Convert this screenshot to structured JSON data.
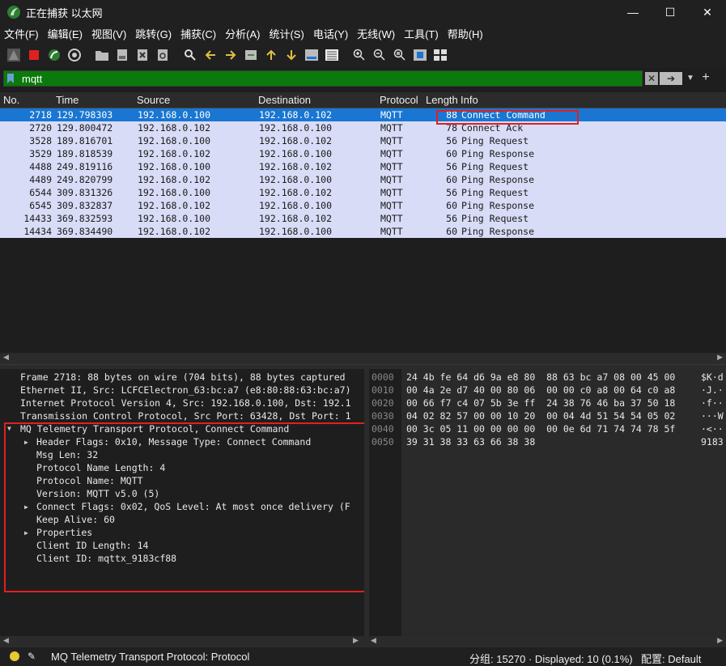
{
  "window": {
    "title": "正在捕获 以太网"
  },
  "menu": [
    "文件(F)",
    "编辑(E)",
    "视图(V)",
    "跳转(G)",
    "捕获(C)",
    "分析(A)",
    "统计(S)",
    "电话(Y)",
    "无线(W)",
    "工具(T)",
    "帮助(H)"
  ],
  "filter": {
    "value": "mqtt",
    "bg_color": "#0a7a0a"
  },
  "columns": {
    "no": "No.",
    "time": "Time",
    "source": "Source",
    "destination": "Destination",
    "protocol": "Protocol",
    "length": "Length",
    "info": "Info"
  },
  "packets": [
    {
      "no": "2718",
      "time": "129.798303",
      "src": "192.168.0.100",
      "dst": "192.168.0.102",
      "proto": "MQTT",
      "len": "88",
      "info": "Connect Command"
    },
    {
      "no": "2720",
      "time": "129.800472",
      "src": "192.168.0.102",
      "dst": "192.168.0.100",
      "proto": "MQTT",
      "len": "78",
      "info": "Connect Ack"
    },
    {
      "no": "3528",
      "time": "189.816701",
      "src": "192.168.0.100",
      "dst": "192.168.0.102",
      "proto": "MQTT",
      "len": "56",
      "info": "Ping Request"
    },
    {
      "no": "3529",
      "time": "189.818539",
      "src": "192.168.0.102",
      "dst": "192.168.0.100",
      "proto": "MQTT",
      "len": "60",
      "info": "Ping Response"
    },
    {
      "no": "4488",
      "time": "249.819116",
      "src": "192.168.0.100",
      "dst": "192.168.0.102",
      "proto": "MQTT",
      "len": "56",
      "info": "Ping Request"
    },
    {
      "no": "4489",
      "time": "249.820799",
      "src": "192.168.0.102",
      "dst": "192.168.0.100",
      "proto": "MQTT",
      "len": "60",
      "info": "Ping Response"
    },
    {
      "no": "6544",
      "time": "309.831326",
      "src": "192.168.0.100",
      "dst": "192.168.0.102",
      "proto": "MQTT",
      "len": "56",
      "info": "Ping Request"
    },
    {
      "no": "6545",
      "time": "309.832837",
      "src": "192.168.0.102",
      "dst": "192.168.0.100",
      "proto": "MQTT",
      "len": "60",
      "info": "Ping Response"
    },
    {
      "no": "14433",
      "time": "369.832593",
      "src": "192.168.0.100",
      "dst": "192.168.0.102",
      "proto": "MQTT",
      "len": "56",
      "info": "Ping Request"
    },
    {
      "no": "14434",
      "time": "369.834490",
      "src": "192.168.0.102",
      "dst": "192.168.0.100",
      "proto": "MQTT",
      "len": "60",
      "info": "Ping Response"
    }
  ],
  "details": [
    {
      "indent": 0,
      "arrow": "right",
      "text": "Frame 2718: 88 bytes on wire (704 bits), 88 bytes captured"
    },
    {
      "indent": 0,
      "arrow": "right",
      "text": "Ethernet II, Src: LCFCElectron_63:bc:a7 (e8:80:88:63:bc:a7)"
    },
    {
      "indent": 0,
      "arrow": "right",
      "text": "Internet Protocol Version 4, Src: 192.168.0.100, Dst: 192.1"
    },
    {
      "indent": 0,
      "arrow": "right",
      "text": "Transmission Control Protocol, Src Port: 63428, Dst Port: 1"
    },
    {
      "indent": 0,
      "arrow": "down",
      "text": "MQ Telemetry Transport Protocol, Connect Command"
    },
    {
      "indent": 1,
      "arrow": "right",
      "text": "Header Flags: 0x10, Message Type: Connect Command"
    },
    {
      "indent": 1,
      "arrow": "",
      "text": "Msg Len: 32"
    },
    {
      "indent": 1,
      "arrow": "",
      "text": "Protocol Name Length: 4"
    },
    {
      "indent": 1,
      "arrow": "",
      "text": "Protocol Name: MQTT"
    },
    {
      "indent": 1,
      "arrow": "",
      "text": "Version: MQTT v5.0 (5)"
    },
    {
      "indent": 1,
      "arrow": "right",
      "text": "Connect Flags: 0x02, QoS Level: At most once delivery (F"
    },
    {
      "indent": 1,
      "arrow": "",
      "text": "Keep Alive: 60"
    },
    {
      "indent": 1,
      "arrow": "right",
      "text": "Properties"
    },
    {
      "indent": 1,
      "arrow": "",
      "text": "Client ID Length: 14"
    },
    {
      "indent": 1,
      "arrow": "",
      "text": "Client ID: mqttx_9183cf88"
    }
  ],
  "bytes": [
    {
      "offset": "0000",
      "hex": "24 4b fe 64 d6 9a e8 80  88 63 bc a7 08 00 45 00",
      "ascii": "$K·d"
    },
    {
      "offset": "0010",
      "hex": "00 4a 2e d7 40 00 80 06  00 00 c0 a8 00 64 c0 a8",
      "ascii": "·J.·"
    },
    {
      "offset": "0020",
      "hex": "00 66 f7 c4 07 5b 3e ff  24 38 76 46 ba 37 50 18",
      "ascii": "·f··"
    },
    {
      "offset": "0030",
      "hex": "04 02 82 57 00 00 10 20  00 04 4d 51 54 54 05 02",
      "ascii": "···W"
    },
    {
      "offset": "0040",
      "hex": "00 3c 05 11 00 00 00 00  00 0e 6d 71 74 74 78 5f",
      "ascii": "·<··"
    },
    {
      "offset": "0050",
      "hex": "39 31 38 33 63 66 38 38",
      "ascii": "9183"
    }
  ],
  "status": {
    "protocol_text": "MQ Telemetry Transport Protocol: Protocol",
    "packets_text": "分组: 15270 · Displayed: 10 (0.1%)",
    "profile_text": "配置: Default"
  }
}
